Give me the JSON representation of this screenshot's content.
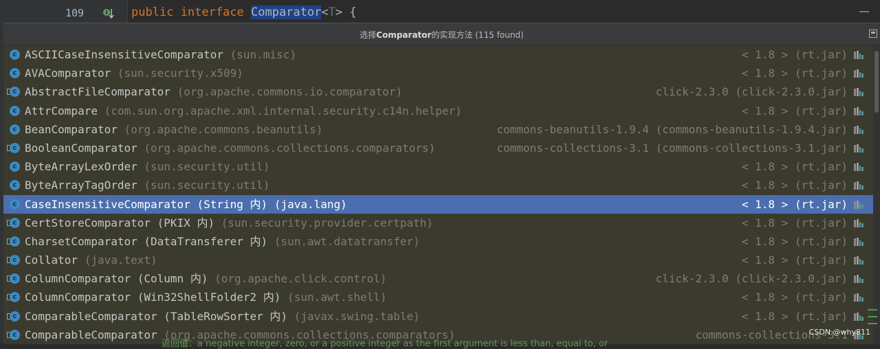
{
  "editor": {
    "line_number": "109",
    "code": {
      "kw1": "public",
      "kw2": "interface",
      "classname": "Comparator",
      "open": "<",
      "tparam": "T",
      "close": "> {"
    }
  },
  "popup": {
    "title_prefix": "选择",
    "title_class": "Comparator",
    "title_suffix": "的实现方法 (115 found)"
  },
  "rows": [
    {
      "name": "ASCIICaseInsensitiveComparator",
      "extra": "",
      "pkg": "(sun.misc)",
      "loc": "< 1.8 > (rt.jar)"
    },
    {
      "name": "AVAComparator",
      "extra": "",
      "pkg": "(sun.security.x509)",
      "loc": "< 1.8 > (rt.jar)"
    },
    {
      "name": "AbstractFileComparator",
      "extra": "",
      "pkg": "(org.apache.commons.io.comparator)",
      "loc": "click-2.3.0 (click-2.3.0.jar)"
    },
    {
      "name": "AttrCompare",
      "extra": "",
      "pkg": "(com.sun.org.apache.xml.internal.security.c14n.helper)",
      "loc": "< 1.8 > (rt.jar)"
    },
    {
      "name": "BeanComparator",
      "extra": "",
      "pkg": "(org.apache.commons.beanutils)",
      "loc": "commons-beanutils-1.9.4 (commons-beanutils-1.9.4.jar)"
    },
    {
      "name": "BooleanComparator",
      "extra": "",
      "pkg": "(org.apache.commons.collections.comparators)",
      "loc": "commons-collections-3.1 (commons-collections-3.1.jar)"
    },
    {
      "name": "ByteArrayLexOrder",
      "extra": "",
      "pkg": "(sun.security.util)",
      "loc": "< 1.8 > (rt.jar)"
    },
    {
      "name": "ByteArrayTagOrder",
      "extra": "",
      "pkg": "(sun.security.util)",
      "loc": "< 1.8 > (rt.jar)"
    },
    {
      "name": "CaseInsensitiveComparator",
      "extra": " (String 内)",
      "pkg": "(java.lang)",
      "loc": "< 1.8 > (rt.jar)",
      "selected": true
    },
    {
      "name": "CertStoreComparator",
      "extra": " (PKIX 内)",
      "pkg": "(sun.security.provider.certpath)",
      "loc": "< 1.8 > (rt.jar)"
    },
    {
      "name": "CharsetComparator",
      "extra": " (DataTransferer 内)",
      "pkg": "(sun.awt.datatransfer)",
      "loc": "< 1.8 > (rt.jar)"
    },
    {
      "name": "Collator",
      "extra": "",
      "pkg": "(java.text)",
      "loc": "< 1.8 > (rt.jar)"
    },
    {
      "name": "ColumnComparator",
      "extra": " (Column 内)",
      "pkg": "(org.apache.click.control)",
      "loc": "click-2.3.0 (click-2.3.0.jar)"
    },
    {
      "name": "ColumnComparator",
      "extra": " (Win32ShellFolder2 内)",
      "pkg": "(sun.awt.shell)",
      "loc": "< 1.8 > (rt.jar)"
    },
    {
      "name": "ComparableComparator",
      "extra": " (TableRowSorter 内)",
      "pkg": "(javax.swing.table)",
      "loc": "< 1.8 > (rt.jar)"
    },
    {
      "name": "ComparableComparator",
      "extra": "",
      "pkg": "(org.apache.commons.collections.comparators)",
      "loc": "commons-collections-3.1"
    }
  ],
  "doc_strip": "返回值：a negative integer, zero, or a positive integer as the first argument is less than, equal to, or",
  "watermark": "CSDN @why811",
  "colors": {
    "selection": "#4b6eaf",
    "popup_bg": "#3b3a2e",
    "class_icon": "#3d8ac2",
    "keyword": "#cc7832"
  }
}
